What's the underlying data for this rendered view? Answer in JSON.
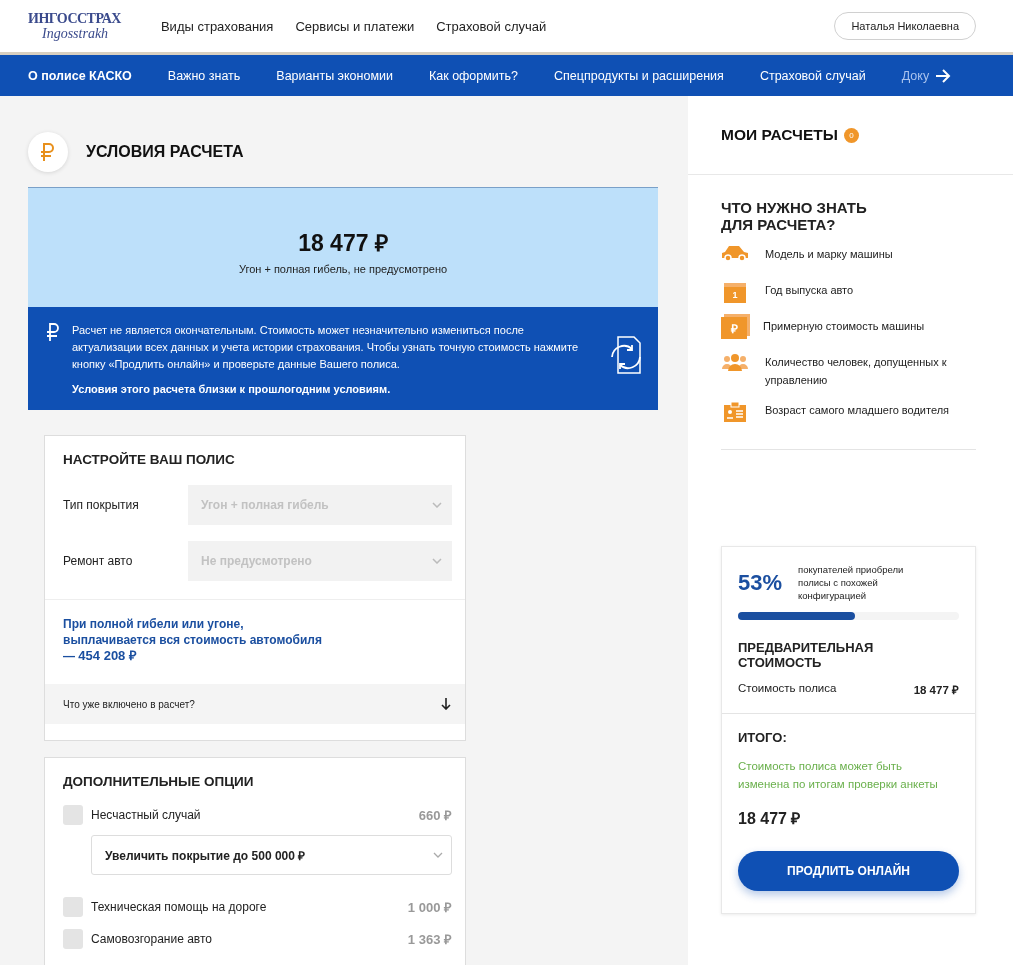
{
  "header": {
    "logo": "ИНГОССТРАХ",
    "logo_script": "Ingosstrakh",
    "links": [
      "Виды страхования",
      "Сервисы и платежи",
      "Страховой случай"
    ],
    "user": "Наталья Николаевна"
  },
  "subnav": {
    "items": [
      {
        "label": "О полисе КАСКО",
        "selected": true
      },
      {
        "label": "Важно знать",
        "selected": false
      },
      {
        "label": "Варианты экономии",
        "selected": false
      },
      {
        "label": "Как оформить?",
        "selected": false
      },
      {
        "label": "Спецпродукты и расширения",
        "selected": false
      },
      {
        "label": "Страховой случай",
        "selected": false
      },
      {
        "label": "Доку",
        "selected": false
      }
    ]
  },
  "calc": {
    "title": "УСЛОВИЯ РАСЧЕТА",
    "price": "18 477 ₽",
    "summary": "Угон + полная гибель, не предусмотрено",
    "notice": "Расчет не является окончательным. Стоимость может незначительно измениться после актуализации всех данных и учета истории страхования. Чтобы узнать точную стоимость нажмите кнопку «Продлить онлайн» и проверьте данные Вашего полиса.",
    "notice_bold": "Условия этого расчета близки к прошлогодним условиям."
  },
  "policy": {
    "title": "НАСТРОЙТЕ ВАШ ПОЛИС",
    "fields": [
      {
        "label": "Тип покрытия",
        "value": "Угон + полная гибель",
        "disabled": true
      },
      {
        "label": "Ремонт авто",
        "value": "Не предусмотрено",
        "disabled": true
      }
    ],
    "payout": "При полной гибели или угоне, выплачивается вся стоимость автомобиля — **454 208 ₽**",
    "included": {
      "label": "Что уже включено в расчет?",
      "expanded": false
    }
  },
  "options": {
    "title": "ДОПОЛНИТЕЛЬНЫЕ ОПЦИИ",
    "items": [
      {
        "kind": "checkbox",
        "label": "Несчастный случай",
        "price": "660 ₽",
        "checked": false
      },
      {
        "kind": "select",
        "value": "Увеличить покрытие до **500 000 ₽**"
      },
      {
        "kind": "checkbox",
        "label": "Техническая помощь на дороге",
        "price": "1 000 ₽",
        "checked": false
      },
      {
        "kind": "checkbox",
        "label": "Самовозгорание авто",
        "price": "1 363 ₽",
        "checked": false
      }
    ]
  },
  "my_calcs": {
    "title": "МОИ РАСЧЕТЫ",
    "count": "0"
  },
  "need": {
    "title": "ЧТО НУЖНО ЗНАТЬ ДЛЯ РАСЧЕТА?",
    "items": [
      {
        "kind": "car",
        "text": "Модель и марку машины"
      },
      {
        "kind": "calendar",
        "text": "Год выпуска авто",
        "icon_text": "1"
      },
      {
        "kind": "money",
        "text": "Примерную стоимость машины",
        "icon_text": "₽"
      },
      {
        "kind": "people",
        "text": "Количество человек, допущенных к управлению"
      },
      {
        "kind": "id",
        "text": "Возраст самого младшего водителя"
      }
    ]
  },
  "summary": {
    "percent": "53%",
    "percent_text": "покупателей приобрели полисы с похожей конфигурацией",
    "level": 0.53,
    "pre_title": "ПРЕДВАРИТЕЛЬНАЯ СТОИМОСТЬ",
    "row_label": "Стоимость полиса",
    "row_value": "18 477 ₽",
    "total_title": "ИТОГО:",
    "total_note": "Стоимость полиса может быть изменена по итогам проверки анкеты",
    "total": "18 477 ₽",
    "button": "ПРОДЛИТЬ ОНЛАЙН"
  }
}
